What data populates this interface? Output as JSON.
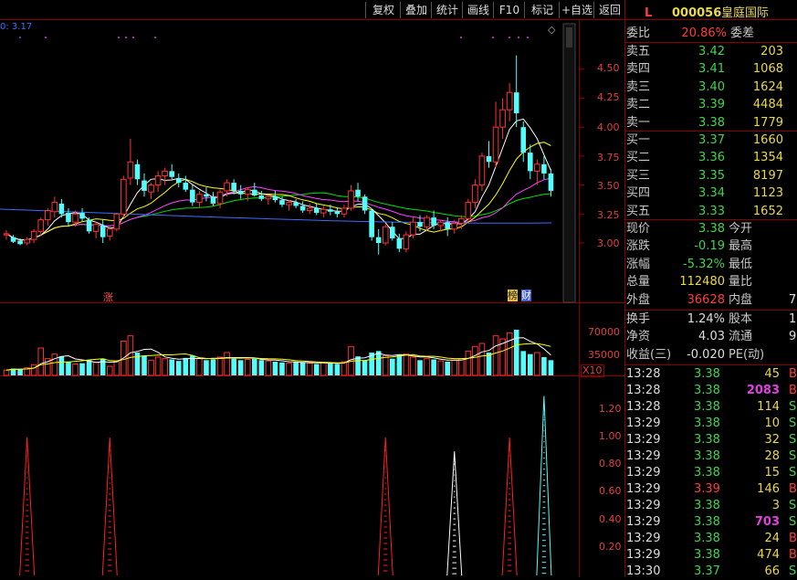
{
  "toolbar": {
    "buttons": [
      "复权",
      "叠加",
      "统计",
      "画线",
      "F10",
      "标记",
      "+自选",
      "返回"
    ]
  },
  "chart_header": {
    "ma_text": "0: 3.17"
  },
  "stock": {
    "flag": "L",
    "code": "000056",
    "name": "皇庭国际"
  },
  "quote": {
    "weibi_label": "委比",
    "weibi_value": "20.86%",
    "weicha_label": "委差",
    "asks": [
      {
        "label": "卖五",
        "price": "3.42",
        "vol": "203"
      },
      {
        "label": "卖四",
        "price": "3.41",
        "vol": "1068"
      },
      {
        "label": "卖三",
        "price": "3.40",
        "vol": "1624"
      },
      {
        "label": "卖二",
        "price": "3.39",
        "vol": "4484"
      },
      {
        "label": "卖一",
        "price": "3.38",
        "vol": "1779"
      }
    ],
    "bids": [
      {
        "label": "买一",
        "price": "3.37",
        "vol": "1660"
      },
      {
        "label": "买二",
        "price": "3.36",
        "vol": "1354"
      },
      {
        "label": "买三",
        "price": "3.35",
        "vol": "8197"
      },
      {
        "label": "买四",
        "price": "3.34",
        "vol": "1123"
      },
      {
        "label": "买五",
        "price": "3.33",
        "vol": "1652"
      }
    ],
    "stats": [
      {
        "l1": "现价",
        "v1": "3.38",
        "l2": "今开",
        "v2": ""
      },
      {
        "l1": "涨跌",
        "v1": "-0.19",
        "l2": "最高",
        "v2": ""
      },
      {
        "l1": "涨幅",
        "v1": "-5.32%",
        "l2": "最低",
        "v2": ""
      },
      {
        "l1": "总量",
        "v1": "112480",
        "l2": "量比",
        "v2": ""
      },
      {
        "l1": "外盘",
        "v1": "36628",
        "l2": "内盘",
        "v2": "7"
      }
    ],
    "extra": [
      {
        "l1": "换手",
        "v1": "1.24%",
        "l2": "股本",
        "v2": "1"
      },
      {
        "l1": "净资",
        "v1": "4.03",
        "l2": "流通",
        "v2": "9."
      },
      {
        "l1": "收益(三)",
        "v1": "-0.020",
        "l2": "PE(动)",
        "v2": ""
      }
    ]
  },
  "ticks": [
    {
      "time": "13:28",
      "price": "3.38",
      "vol": "45",
      "side": "B"
    },
    {
      "time": "13:28",
      "price": "3.38",
      "vol": "2083",
      "side": "B"
    },
    {
      "time": "13:28",
      "price": "3.38",
      "vol": "114",
      "side": "S"
    },
    {
      "time": "13:29",
      "price": "3.38",
      "vol": "10",
      "side": "S"
    },
    {
      "time": "13:29",
      "price": "3.38",
      "vol": "32",
      "side": "S"
    },
    {
      "time": "13:29",
      "price": "3.38",
      "vol": "28",
      "side": "S"
    },
    {
      "time": "13:29",
      "price": "3.38",
      "vol": "15",
      "side": "S"
    },
    {
      "time": "13:29",
      "price": "3.39",
      "vol": "146",
      "side": "B"
    },
    {
      "time": "13:29",
      "price": "3.38",
      "vol": "3",
      "side": "S"
    },
    {
      "time": "13:29",
      "price": "3.38",
      "vol": "703",
      "side": "S"
    },
    {
      "time": "13:29",
      "price": "3.38",
      "vol": "24",
      "side": "B"
    },
    {
      "time": "13:29",
      "price": "3.38",
      "vol": "474",
      "side": "B"
    },
    {
      "time": "13:30",
      "price": "3.37",
      "vol": "66",
      "side": "S"
    }
  ],
  "price_axis": {
    "ticks": [
      "4.50",
      "4.25",
      "4.00",
      "3.75",
      "3.50",
      "3.25",
      "3.00"
    ]
  },
  "volume_axis": {
    "ticks": [
      "70000",
      "35000"
    ],
    "multiplier": "X10"
  },
  "indicator_axis": {
    "ticks": [
      "1.20",
      "1.00",
      "0.80",
      "0.60",
      "0.40",
      "0.20"
    ]
  },
  "markers": {
    "zhang": "涨",
    "bang": "榜",
    "cai": "财"
  },
  "colors": {
    "up": "#ff3232",
    "down": "#54fcfc",
    "ma5": "#ffffff",
    "ma10": "#ffff00",
    "ma20": "#ff40ff",
    "ma60": "#00e000"
  },
  "chart_data": {
    "type": "candlestick",
    "candles": [
      [
        3.07,
        3.11,
        3.03,
        3.08
      ],
      [
        3.05,
        3.07,
        3.0,
        3.01
      ],
      [
        3.02,
        3.04,
        2.98,
        2.99
      ],
      [
        3.0,
        3.05,
        2.98,
        3.03
      ],
      [
        3.03,
        3.12,
        3.0,
        3.1
      ],
      [
        3.1,
        3.22,
        3.06,
        3.2
      ],
      [
        3.2,
        3.3,
        3.15,
        3.28
      ],
      [
        3.27,
        3.4,
        3.22,
        3.35
      ],
      [
        3.34,
        3.38,
        3.22,
        3.25
      ],
      [
        3.26,
        3.3,
        3.14,
        3.18
      ],
      [
        3.18,
        3.28,
        3.14,
        3.25
      ],
      [
        3.26,
        3.3,
        3.18,
        3.21
      ],
      [
        3.2,
        3.22,
        3.08,
        3.1
      ],
      [
        3.1,
        3.18,
        3.04,
        3.16
      ],
      [
        3.15,
        3.2,
        3.0,
        3.05
      ],
      [
        3.06,
        3.14,
        3.02,
        3.12
      ],
      [
        3.12,
        3.26,
        3.1,
        3.25
      ],
      [
        3.25,
        3.58,
        3.22,
        3.55
      ],
      [
        3.56,
        3.9,
        3.5,
        3.7
      ],
      [
        3.68,
        3.72,
        3.5,
        3.55
      ],
      [
        3.54,
        3.6,
        3.4,
        3.45
      ],
      [
        3.44,
        3.52,
        3.38,
        3.5
      ],
      [
        3.5,
        3.62,
        3.44,
        3.58
      ],
      [
        3.58,
        3.65,
        3.5,
        3.62
      ],
      [
        3.62,
        3.68,
        3.55,
        3.57
      ],
      [
        3.56,
        3.6,
        3.48,
        3.52
      ],
      [
        3.52,
        3.58,
        3.44,
        3.46
      ],
      [
        3.46,
        3.5,
        3.32,
        3.35
      ],
      [
        3.35,
        3.45,
        3.3,
        3.42
      ],
      [
        3.42,
        3.48,
        3.36,
        3.4
      ],
      [
        3.4,
        3.44,
        3.32,
        3.34
      ],
      [
        3.34,
        3.46,
        3.3,
        3.44
      ],
      [
        3.45,
        3.55,
        3.4,
        3.52
      ],
      [
        3.52,
        3.55,
        3.42,
        3.45
      ],
      [
        3.45,
        3.5,
        3.38,
        3.42
      ],
      [
        3.42,
        3.48,
        3.36,
        3.46
      ],
      [
        3.46,
        3.52,
        3.4,
        3.41
      ],
      [
        3.41,
        3.45,
        3.36,
        3.38
      ],
      [
        3.38,
        3.42,
        3.33,
        3.4
      ],
      [
        3.4,
        3.45,
        3.35,
        3.37
      ],
      [
        3.37,
        3.4,
        3.31,
        3.33
      ],
      [
        3.33,
        3.37,
        3.28,
        3.35
      ],
      [
        3.35,
        3.38,
        3.3,
        3.32
      ],
      [
        3.32,
        3.36,
        3.26,
        3.28
      ],
      [
        3.28,
        3.34,
        3.25,
        3.3
      ],
      [
        3.3,
        3.34,
        3.24,
        3.26
      ],
      [
        3.26,
        3.32,
        3.22,
        3.29
      ],
      [
        3.29,
        3.33,
        3.24,
        3.27
      ],
      [
        3.27,
        3.31,
        3.22,
        3.25
      ],
      [
        3.25,
        3.33,
        3.22,
        3.3
      ],
      [
        3.3,
        3.5,
        3.28,
        3.45
      ],
      [
        3.46,
        3.52,
        3.36,
        3.4
      ],
      [
        3.4,
        3.42,
        3.25,
        3.28
      ],
      [
        3.28,
        3.3,
        3.02,
        3.05
      ],
      [
        3.05,
        3.12,
        2.9,
        3.0
      ],
      [
        3.0,
        3.16,
        2.98,
        3.14
      ],
      [
        3.14,
        3.18,
        3.02,
        3.04
      ],
      [
        3.04,
        3.08,
        2.92,
        2.95
      ],
      [
        2.95,
        3.1,
        2.92,
        3.07
      ],
      [
        3.07,
        3.22,
        3.04,
        3.18
      ],
      [
        3.18,
        3.24,
        3.1,
        3.14
      ],
      [
        3.14,
        3.24,
        3.1,
        3.22
      ],
      [
        3.22,
        3.28,
        3.12,
        3.15
      ],
      [
        3.15,
        3.2,
        3.1,
        3.18
      ],
      [
        3.18,
        3.22,
        3.06,
        3.12
      ],
      [
        3.12,
        3.2,
        3.08,
        3.17
      ],
      [
        3.17,
        3.24,
        3.12,
        3.21
      ],
      [
        3.21,
        3.38,
        3.18,
        3.35
      ],
      [
        3.35,
        3.55,
        3.3,
        3.5
      ],
      [
        3.5,
        3.78,
        3.45,
        3.75
      ],
      [
        3.75,
        3.88,
        3.65,
        3.7
      ],
      [
        3.7,
        4.22,
        3.65,
        4.0
      ],
      [
        4.0,
        4.25,
        3.9,
        4.15
      ],
      [
        4.15,
        4.38,
        4.05,
        4.3
      ],
      [
        4.3,
        4.62,
        4.0,
        4.12
      ],
      [
        4.0,
        4.05,
        3.7,
        3.78
      ],
      [
        3.78,
        3.85,
        3.55,
        3.62
      ],
      [
        3.62,
        3.72,
        3.5,
        3.68
      ],
      [
        3.68,
        3.75,
        3.55,
        3.6
      ],
      [
        3.6,
        3.64,
        3.4,
        3.45
      ]
    ],
    "volume": [
      7,
      9,
      8,
      10,
      14,
      36,
      22,
      28,
      25,
      18,
      15,
      16,
      20,
      17,
      22,
      12,
      18,
      45,
      52,
      30,
      26,
      20,
      24,
      22,
      21,
      19,
      23,
      26,
      22,
      20,
      21,
      24,
      30,
      22,
      20,
      21,
      22,
      20,
      19,
      18,
      17,
      16,
      18,
      17,
      16,
      15,
      17,
      16,
      15,
      18,
      38,
      25,
      20,
      30,
      32,
      26,
      22,
      27,
      28,
      24,
      20,
      22,
      21,
      19,
      18,
      20,
      22,
      32,
      38,
      42,
      30,
      52,
      48,
      56,
      60,
      32,
      28,
      30,
      24,
      20
    ],
    "signals": [
      {
        "index": 3,
        "value": 1.0,
        "color": "red"
      },
      {
        "index": 15,
        "value": 1.0,
        "color": "red"
      },
      {
        "index": 55,
        "value": 1.0,
        "color": "red"
      },
      {
        "index": 65,
        "value": 0.9,
        "color": "white"
      },
      {
        "index": 73,
        "value": 1.0,
        "color": "red"
      },
      {
        "index": 78,
        "value": 1.3,
        "color": "cyan"
      }
    ]
  }
}
